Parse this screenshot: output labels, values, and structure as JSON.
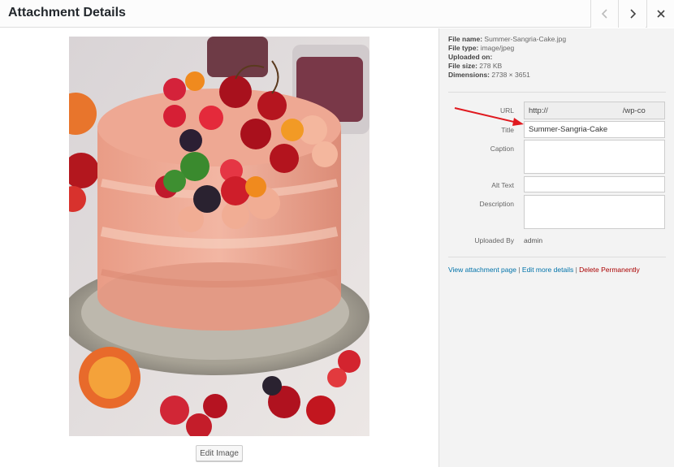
{
  "header": {
    "title": "Attachment Details"
  },
  "media": {
    "edit_image_label": "Edit Image"
  },
  "details": {
    "file_name_label": "File name:",
    "file_name": "Summer-Sangria-Cake.jpg",
    "file_type_label": "File type:",
    "file_type": "image/jpeg",
    "uploaded_on_label": "Uploaded on:",
    "uploaded_on": "",
    "file_size_label": "File size:",
    "file_size": "278 KB",
    "dimensions_label": "Dimensions:",
    "dimensions": "2738 × 3651"
  },
  "form": {
    "url_label": "URL",
    "url_start": "http://",
    "url_end": "/wp-co",
    "title_label": "Title",
    "title_value": "Summer-Sangria-Cake",
    "caption_label": "Caption",
    "caption_value": "",
    "alt_label": "Alt Text",
    "alt_value": "",
    "description_label": "Description",
    "description_value": "",
    "uploaded_by_label": "Uploaded By",
    "uploaded_by_value": "admin"
  },
  "actions": {
    "view_page": "View attachment page",
    "sep1": " | ",
    "edit_more": "Edit more details",
    "sep2": " | ",
    "delete": "Delete Permanently"
  },
  "colors": {
    "link": "#0073aa",
    "delete": "#aa0000",
    "annotation_arrow": "#e0191f"
  }
}
